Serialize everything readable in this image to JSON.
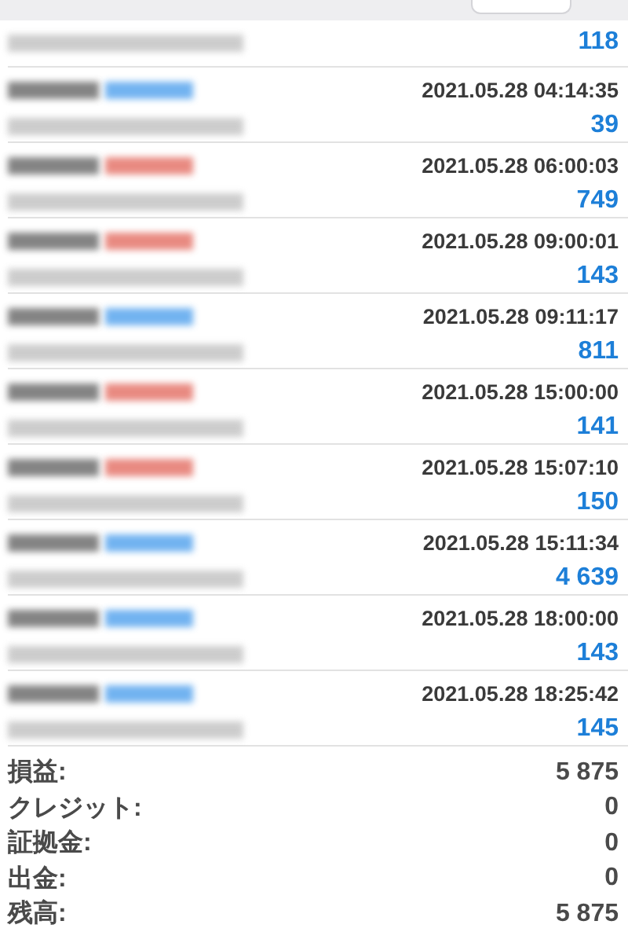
{
  "trades": [
    {
      "kind": "partial",
      "profit": "118"
    },
    {
      "kind": "buy",
      "time": "2021.05.28 04:14:35",
      "profit": "39"
    },
    {
      "kind": "sell",
      "time": "2021.05.28 06:00:03",
      "profit": "749"
    },
    {
      "kind": "sell",
      "time": "2021.05.28 09:00:01",
      "profit": "143"
    },
    {
      "kind": "buy",
      "time": "2021.05.28 09:11:17",
      "profit": "811"
    },
    {
      "kind": "sell",
      "time": "2021.05.28 15:00:00",
      "profit": "141"
    },
    {
      "kind": "sell",
      "time": "2021.05.28 15:07:10",
      "profit": "150"
    },
    {
      "kind": "buy",
      "time": "2021.05.28 15:11:34",
      "profit": "4 639"
    },
    {
      "kind": "buy",
      "time": "2021.05.28 18:00:00",
      "profit": "143"
    },
    {
      "kind": "buy",
      "time": "2021.05.28 18:25:42",
      "profit": "145"
    }
  ],
  "summary": [
    {
      "label": "損益:",
      "value": "5 875"
    },
    {
      "label": "クレジット:",
      "value": "0"
    },
    {
      "label": "証拠金:",
      "value": "0"
    },
    {
      "label": "出金:",
      "value": "0"
    },
    {
      "label": "残高:",
      "value": "5 875"
    }
  ]
}
